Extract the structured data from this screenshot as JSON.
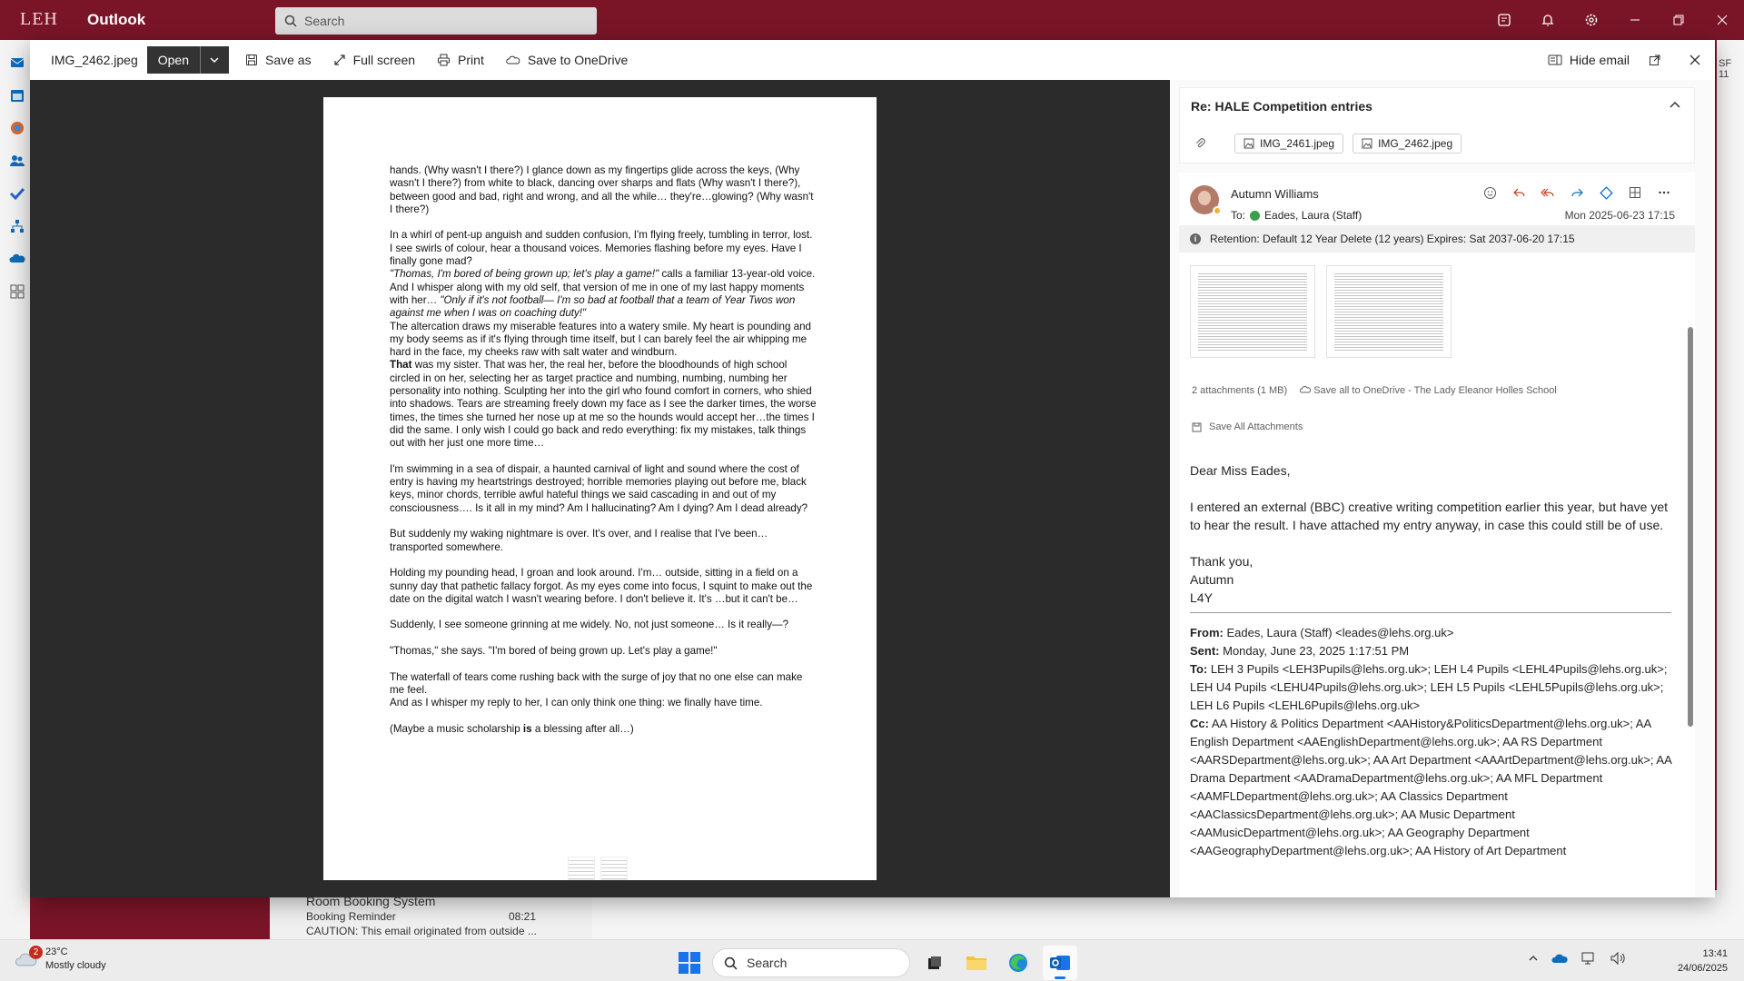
{
  "app": {
    "logo": "LEH",
    "name": "Outlook",
    "search_placeholder": "Search"
  },
  "background": {
    "list_item": {
      "sender": "Room Booking System",
      "subject": "Booking Reminder",
      "time": "08:21",
      "preview": "CAUTION: This email originated from outside ..."
    },
    "right_edge_label": "SF 11"
  },
  "viewer": {
    "filename": "IMG_2462.jpeg",
    "open_label": "Open",
    "save_as_label": "Save as",
    "full_screen_label": "Full screen",
    "print_label": "Print",
    "save_onedrive_label": "Save to OneDrive",
    "hide_email_label": "Hide email"
  },
  "document": {
    "p1": "hands. (Why wasn't I there?) I glance down as my fingertips glide across the keys, (Why wasn't I there?) from white to black, dancing over sharps and flats (Why wasn't I there?), between good and bad, right and wrong, and all the while… they're…glowing? (Why wasn't I there?)",
    "p2a": "In a whirl of pent-up anguish and sudden confusion, I'm flying freely, tumbling in terror, lost.  I see swirls of colour, hear a thousand voices. Memories flashing before my eyes. Have I finally gone mad?",
    "p2b_italic": "\"Thomas, I'm bored of being grown up; let's play a game!\"",
    "p2b_rest": " calls a familiar 13-year-old voice.",
    "p2c": "And I whisper along with my old self, that version of me in one of my last happy moments with her… ",
    "p2c_italic": "\"Only if it's not football— I'm so bad at football that a team of Year Twos won against me when I was on coaching duty!\"",
    "p2d": "The altercation draws my miserable features into a watery smile. My heart is pounding and my body seems as if it's flying through time itself, but I can barely feel the air whipping me hard in the face, my cheeks raw with salt water and windburn.",
    "p2e_bold": "That",
    "p2e_rest": " was my sister. That was her, the real her, before the bloodhounds of high school circled in on her, selecting her as target practice and numbing, numbing, numbing her personality into nothing. Sculpting her into the girl who found comfort in corners, who shied into shadows. Tears are streaming freely down my face as I see the darker times, the worse times, the times she turned her nose up at me so the hounds would accept her…the times I did the same. I only wish I could go back and redo everything: fix my mistakes, talk things out with her just one more time…",
    "p3": "I'm swimming in a sea of dispair, a haunted carnival of light and sound where the cost of entry is having my heartstrings destroyed; horrible memories playing out before me, black keys, minor chords, terrible awful hateful things we said cascading in and out of my consciousness…. Is it all in my mind? Am I hallucinating? Am I dying? Am I dead already?",
    "p4": "But suddenly my waking nightmare is over. It's over, and I realise that I've been…transported somewhere.",
    "p5": "Holding my pounding head, I groan and look around. I'm… outside, sitting in a field on a sunny day that pathetic fallacy forgot. As my eyes come into focus, I squint to make out the date on the digital watch I wasn't wearing before. I don't believe it. It's …but it can't be…",
    "p6": "Suddenly, I see someone grinning at me widely. No, not just someone… Is it really—?",
    "p7": "\"Thomas,\" she says. \"I'm bored of being grown up. Let's play a game!\"",
    "p8a": "The waterfall of tears come rushing back with the surge of joy that no one else can make me feel.",
    "p8b": "And as I whisper my reply to her, I can only think one thing: we finally have time.",
    "p9a": "(Maybe a music scholarship ",
    "p9b_bold": "is",
    "p9c": " a blessing after all…)"
  },
  "email": {
    "subject": "Re: HALE Competition entries",
    "attachments": [
      "IMG_2461.jpeg",
      "IMG_2462.jpeg"
    ],
    "sender": "Autumn Williams",
    "to_label": "To:",
    "to_name": "Eades, Laura (Staff)",
    "date": "Mon 2025-06-23 17:15",
    "retention": "Retention: Default 12 Year Delete (12 years) Expires: Sat 2037-06-20 17:15",
    "attachment_count": "2 attachments (1 MB)",
    "save_all_onedrive": "Save all to OneDrive - The Lady Eleanor Holles School",
    "save_all_attachments": "Save All Attachments",
    "greeting": "Dear Miss Eades,",
    "body": "I entered an external (BBC) creative writing competition earlier this year, but have yet to hear the result. I have attached my entry anyway, in case this could still be of use.",
    "signoff": "Thank you,",
    "sign_name": "Autumn",
    "sign_form": "L4Y",
    "from_label": "From:",
    "from_value": " Eades, Laura (Staff) <leades@lehs.org.uk>",
    "sent_label": "Sent:",
    "sent_value": " Monday, June 23, 2025 1:17:51 PM",
    "to2_label": "To:",
    "to2_value": " LEH 3 Pupils <LEH3Pupils@lehs.org.uk>; LEH L4 Pupils <LEHL4Pupils@lehs.org.uk>; LEH U4 Pupils <LEHU4Pupils@lehs.org.uk>; LEH L5 Pupils <LEHL5Pupils@lehs.org.uk>; LEH L6 Pupils <LEHL6Pupils@lehs.org.uk>",
    "cc_label": "Cc:",
    "cc_value": " AA History & Politics Department <AAHistory&PoliticsDepartment@lehs.org.uk>; AA English Department <AAEnglishDepartment@lehs.org.uk>; AA RS Department <AARSDepartment@lehs.org.uk>; AA Art Department <AAArtDepartment@lehs.org.uk>; AA Drama Department <AADramaDepartment@lehs.org.uk>; AA MFL Department <AAMFLDepartment@lehs.org.uk>; AA Classics Department <AAClassicsDepartment@lehs.org.uk>; AA Music Department <AAMusicDepartment@lehs.org.uk>; AA Geography Department <AAGeographyDepartment@lehs.org.uk>; AA History of Art Department"
  },
  "taskbar": {
    "weather_temp": "23°C",
    "weather_desc": "Mostly cloudy",
    "weather_badge": "2",
    "search_label": "Search",
    "time": "13:41",
    "date": "24/06/2025"
  },
  "colors": {
    "brand": "#7a1528",
    "viewer_bg": "#2b2b2b",
    "accent": "#1a73e8"
  }
}
